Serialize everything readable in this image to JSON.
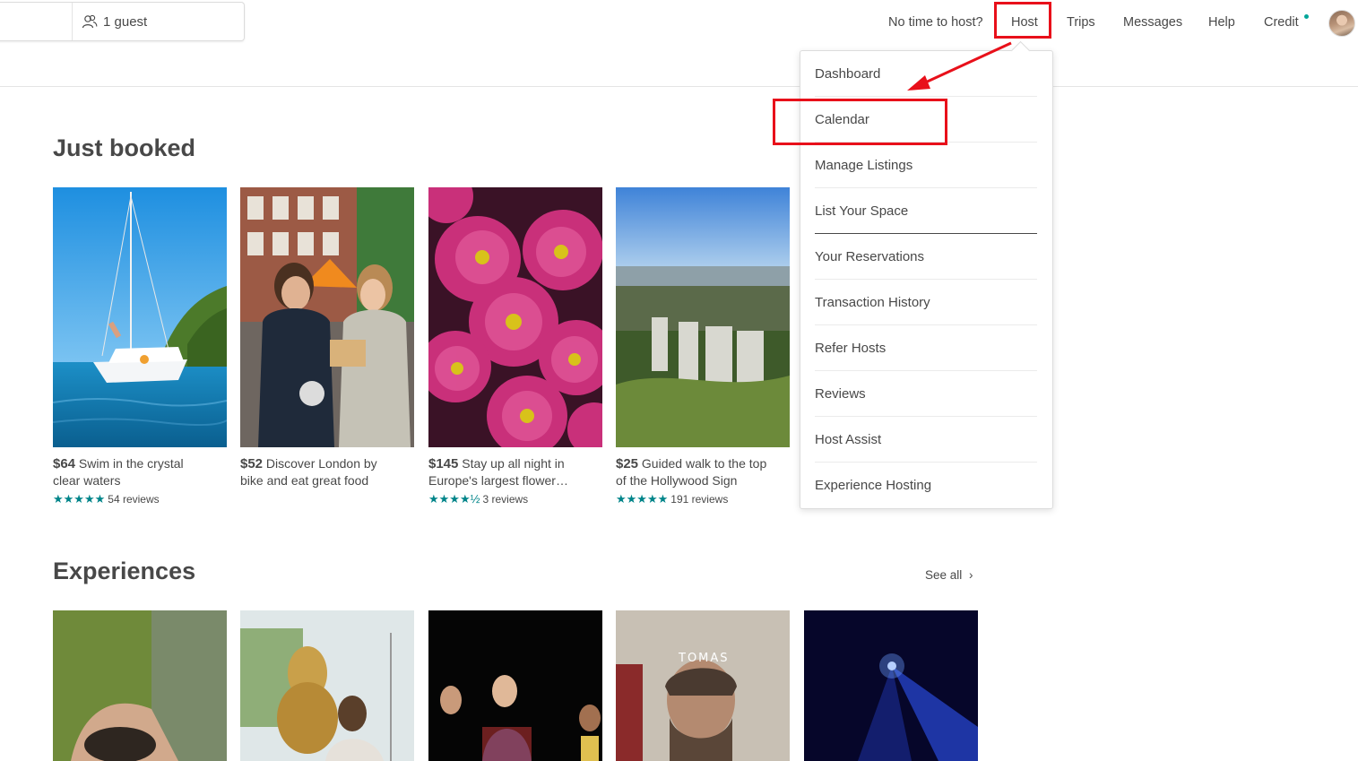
{
  "search": {
    "guest_label": "1 guest"
  },
  "nav": {
    "no_time": "No time to host?",
    "host": "Host",
    "trips": "Trips",
    "messages": "Messages",
    "help": "Help",
    "credit": "Credit"
  },
  "host_menu": {
    "items": [
      "Dashboard",
      "Calendar",
      "Manage Listings",
      "List Your Space",
      "Your Reservations",
      "Transaction History",
      "Refer Hosts",
      "Reviews",
      "Host Assist",
      "Experience Hosting"
    ]
  },
  "just_booked": {
    "title": "Just booked",
    "cards": [
      {
        "price": "$64",
        "title_l1": "Swim in the crystal",
        "title_l2": "clear waters",
        "stars": "★★★★★",
        "reviews": "54 reviews"
      },
      {
        "price": "$52",
        "title_l1": "Discover London by",
        "title_l2": "bike and eat great food",
        "stars": "",
        "reviews": ""
      },
      {
        "price": "$145",
        "title_l1": "Stay up all night in",
        "title_l2": "Europe's largest flower…",
        "stars": "★★★★½",
        "reviews": "3 reviews"
      },
      {
        "price": "$25",
        "title_l1": "Guided walk to the top",
        "title_l2": "of the Hollywood Sign",
        "stars": "★★★★★",
        "reviews": "191 reviews"
      }
    ]
  },
  "experiences": {
    "title": "Experiences",
    "see_all": "See all",
    "tomas_text": "TOMAS"
  },
  "colors": {
    "accent_teal": "#008489",
    "annotation_red": "#e8101a",
    "text": "#484848"
  }
}
